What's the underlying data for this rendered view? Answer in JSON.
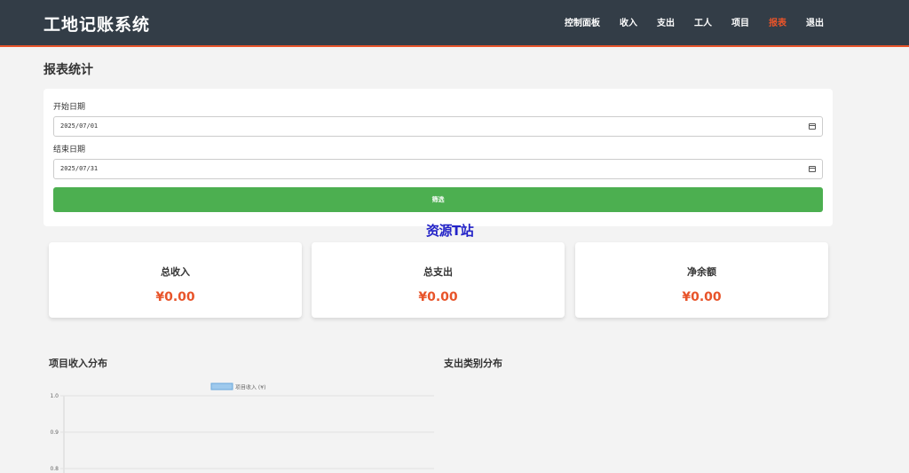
{
  "app": {
    "title": "工地记账系统"
  },
  "nav": {
    "items": [
      {
        "label": "控制面板",
        "active": false
      },
      {
        "label": "收入",
        "active": false
      },
      {
        "label": "支出",
        "active": false
      },
      {
        "label": "工人",
        "active": false
      },
      {
        "label": "项目",
        "active": false
      },
      {
        "label": "报表",
        "active": true
      },
      {
        "label": "退出",
        "active": false
      }
    ]
  },
  "page": {
    "title": "报表统计"
  },
  "filter": {
    "start_label": "开始日期",
    "start_value": "2025/07/01",
    "end_label": "结束日期",
    "end_value": "2025/07/31",
    "button_label": "筛选"
  },
  "watermark": "资源T站",
  "stats": [
    {
      "label": "总收入",
      "value": "¥0.00"
    },
    {
      "label": "总支出",
      "value": "¥0.00"
    },
    {
      "label": "净余额",
      "value": "¥0.00"
    }
  ],
  "sections": {
    "project_income": "项目收入分布",
    "expense_category": "支出类别分布"
  },
  "colors": {
    "header_bg": "#333d47",
    "accent": "#e8542a",
    "button": "#4caf50",
    "legend_fill": "#9ec9ed"
  },
  "chart_data": {
    "type": "bar",
    "categories": [],
    "series": [
      {
        "name": "项目收入 (¥)",
        "values": []
      }
    ],
    "yticks": [
      "1.0",
      "0.9",
      "0.8"
    ],
    "ylim": [
      0,
      1
    ],
    "legend": "top-center",
    "grid": true
  }
}
